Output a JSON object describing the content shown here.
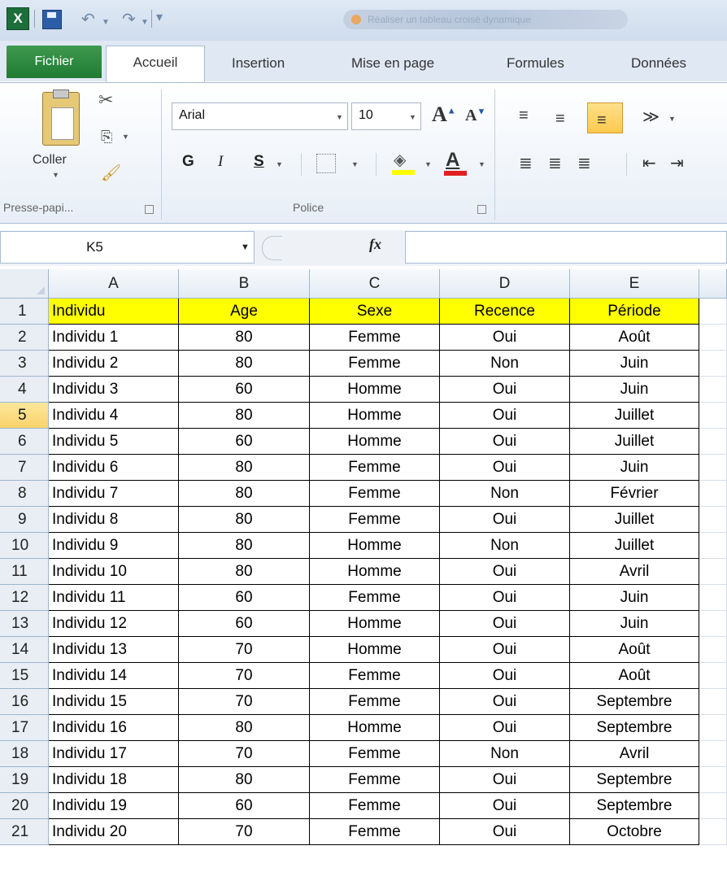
{
  "app": {
    "quick_access": {
      "logo_letter": "X"
    },
    "window_title": "Réaliser un tableau croisé dynamique"
  },
  "tabs": {
    "file": "Fichier",
    "items": [
      "Accueil",
      "Insertion",
      "Mise en page",
      "Formules",
      "Données"
    ],
    "active": "Accueil"
  },
  "ribbon": {
    "clipboard": {
      "paste_label": "Coller",
      "group_label": "Presse-papi..."
    },
    "font": {
      "font_name": "Arial",
      "font_size": "10",
      "bold": "G",
      "italic": "I",
      "underline": "S",
      "font_color_letter": "A",
      "group_label": "Police",
      "fill_color": "#ffff00",
      "font_color": "#e02020"
    }
  },
  "formula_bar": {
    "name_box": "K5",
    "fx": "fx",
    "formula": ""
  },
  "sheet": {
    "columns": [
      "A",
      "B",
      "C",
      "D",
      "E"
    ],
    "selected_row": "5",
    "header_fill": "#ffff00",
    "headers": [
      "Individu",
      "Age",
      "Sexe",
      "Recence",
      "Période"
    ],
    "rows": [
      [
        "2",
        "Individu 1",
        "80",
        "Femme",
        "Oui",
        "Août"
      ],
      [
        "3",
        "Individu 2",
        "80",
        "Femme",
        "Non",
        "Juin"
      ],
      [
        "4",
        "Individu 3",
        "60",
        "Homme",
        "Oui",
        "Juin"
      ],
      [
        "5",
        "Individu 4",
        "80",
        "Homme",
        "Oui",
        "Juillet"
      ],
      [
        "6",
        "Individu 5",
        "60",
        "Homme",
        "Oui",
        "Juillet"
      ],
      [
        "7",
        "Individu 6",
        "80",
        "Femme",
        "Oui",
        "Juin"
      ],
      [
        "8",
        "Individu 7",
        "80",
        "Femme",
        "Non",
        "Février"
      ],
      [
        "9",
        "Individu 8",
        "80",
        "Femme",
        "Oui",
        "Juillet"
      ],
      [
        "10",
        "Individu 9",
        "80",
        "Homme",
        "Non",
        "Juillet"
      ],
      [
        "11",
        "Individu 10",
        "80",
        "Homme",
        "Oui",
        "Avril"
      ],
      [
        "12",
        "Individu 11",
        "60",
        "Femme",
        "Oui",
        "Juin"
      ],
      [
        "13",
        "Individu 12",
        "60",
        "Homme",
        "Oui",
        "Juin"
      ],
      [
        "14",
        "Individu 13",
        "70",
        "Homme",
        "Oui",
        "Août"
      ],
      [
        "15",
        "Individu 14",
        "70",
        "Femme",
        "Oui",
        "Août"
      ],
      [
        "16",
        "Individu 15",
        "70",
        "Femme",
        "Oui",
        "Septembre"
      ],
      [
        "17",
        "Individu 16",
        "80",
        "Homme",
        "Oui",
        "Septembre"
      ],
      [
        "18",
        "Individu 17",
        "70",
        "Femme",
        "Non",
        "Avril"
      ],
      [
        "19",
        "Individu 18",
        "80",
        "Femme",
        "Oui",
        "Septembre"
      ],
      [
        "20",
        "Individu 19",
        "60",
        "Femme",
        "Oui",
        "Septembre"
      ],
      [
        "21",
        "Individu 20",
        "70",
        "Femme",
        "Oui",
        "Octobre"
      ]
    ]
  }
}
